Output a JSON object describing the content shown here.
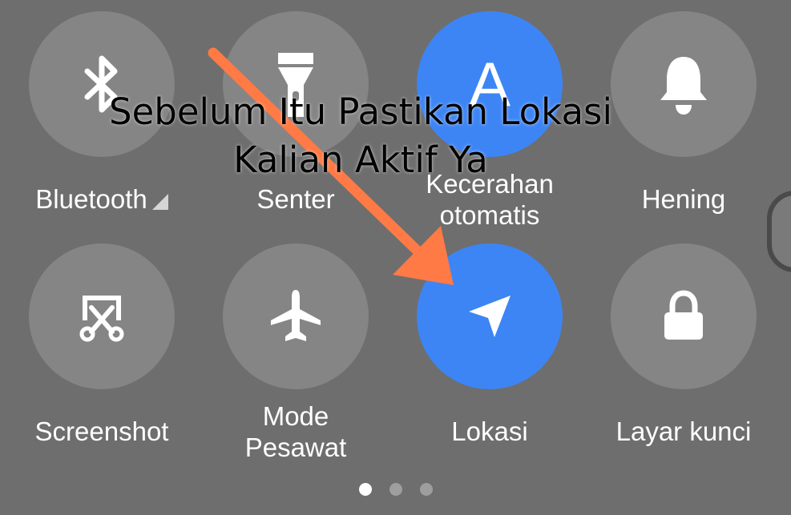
{
  "tiles": [
    {
      "label": "Bluetooth",
      "icon": "bluetooth-icon",
      "active": false
    },
    {
      "label": "Senter",
      "icon": "flashlight-icon",
      "active": false
    },
    {
      "label": "Kecerahan\notomatis",
      "icon": "auto-brightness-icon",
      "glyph": "A",
      "active": true
    },
    {
      "label": "Hening",
      "icon": "bell-icon",
      "active": false
    },
    {
      "label": "Screenshot",
      "icon": "screenshot-scissors-icon",
      "active": false
    },
    {
      "label": "Mode\nPesawat",
      "icon": "airplane-icon",
      "active": false
    },
    {
      "label": "Lokasi",
      "icon": "location-arrow-icon",
      "active": true
    },
    {
      "label": "Layar kunci",
      "icon": "lock-icon",
      "active": false
    }
  ],
  "page_indicator": {
    "pages": 3,
    "current": 1
  },
  "overlay": {
    "caption": "Sebelum Itu Pastikan Lokasi\nKalian Aktif Ya",
    "arrow_color": "#ff7a45"
  },
  "colors": {
    "background": "#6e6e6e",
    "tile": "#858585",
    "tile_active": "#3d85f5",
    "text": "#ffffff"
  }
}
